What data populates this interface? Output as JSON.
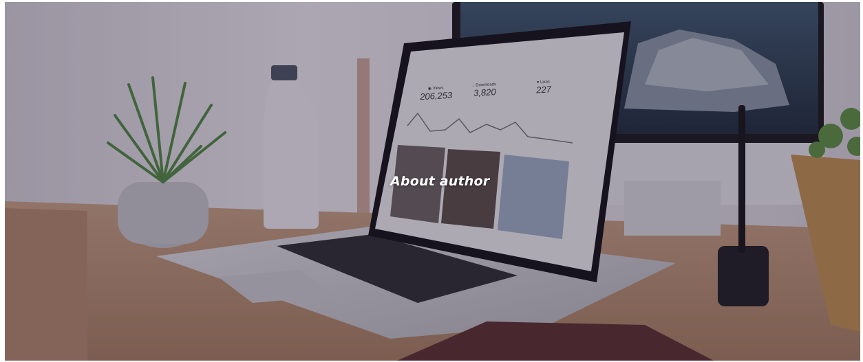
{
  "hero": {
    "title": "About author",
    "image_alt": "Laptop with analytics dashboard on a wooden desk"
  },
  "screen": {
    "stats": [
      {
        "icon": "eye-icon",
        "label": "Views",
        "value": "206,253"
      },
      {
        "icon": "download-icon",
        "label": "Downloads",
        "value": "3,820"
      },
      {
        "icon": "heart-icon",
        "label": "Likes",
        "value": "227"
      }
    ]
  },
  "colors": {
    "overlay": "#281c37",
    "title_text": "#ffffff",
    "desk": "#c49a78",
    "wall": "#e9e5ec"
  }
}
